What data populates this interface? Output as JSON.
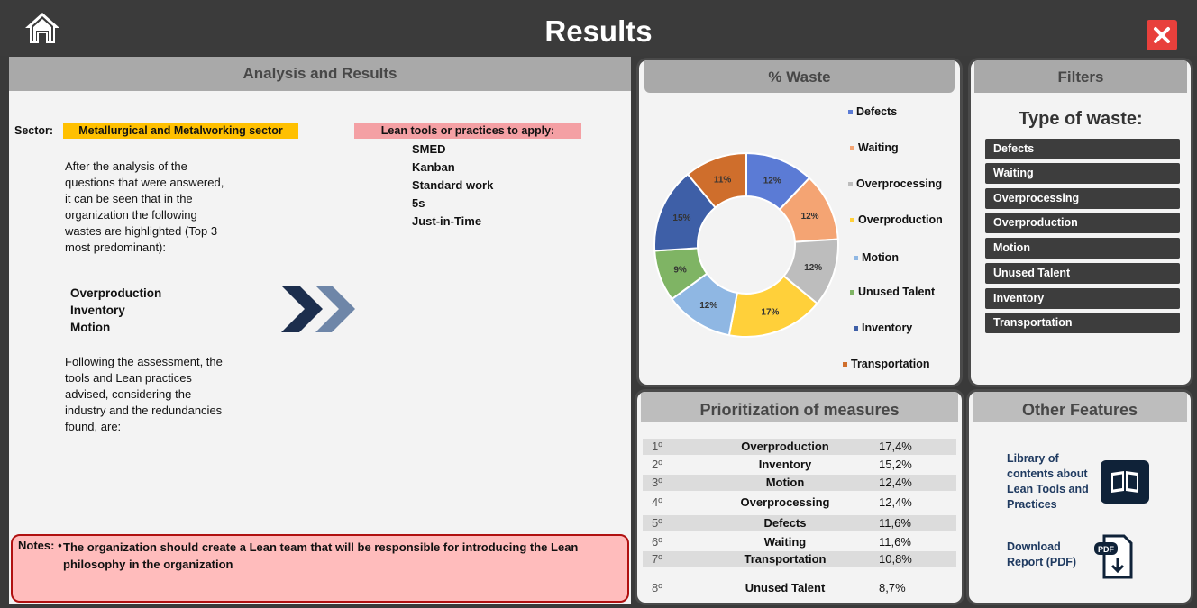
{
  "header": {
    "title": "Results"
  },
  "analysis": {
    "heading": "Analysis and Results",
    "sector_label": "Sector:",
    "sector_value": "Metallurgical and Metalworking sector",
    "intro_lines": [
      "After the analysis of the",
      "questions that were answered,",
      "it can be seen that in the",
      "organization the following",
      "wastes are highlighted (Top 3",
      "most predominant):"
    ],
    "top_wastes": [
      "Overproduction",
      "Inventory",
      "Motion"
    ],
    "followup_lines": [
      "Following the assessment, the",
      "tools and Lean practices",
      "advised, considering the",
      "industry and the redundancies",
      "found, are:"
    ],
    "lean_label": "Lean tools or practices to apply:",
    "lean_tools": [
      "SMED",
      "Kanban",
      "Standard work",
      "5s",
      "Just-in-Time"
    ],
    "notes_label": "Notes:",
    "notes_bullet": "•",
    "notes_text": "The organization should create a Lean team that will be responsible for introducing the Lean philosophy in the organization",
    "arrow_colors": [
      "#1c2e4d",
      "#6e86a8"
    ]
  },
  "waste_chart": {
    "heading": "% Waste",
    "chart_data": {
      "type": "pie",
      "subtype": "donut",
      "categories": [
        "Defects",
        "Waiting",
        "Overprocessing",
        "Overproduction",
        "Motion",
        "Unused Talent",
        "Inventory",
        "Transportation"
      ],
      "values": [
        12,
        12,
        12,
        17,
        12,
        9,
        15,
        11
      ],
      "labels": [
        "12%",
        "12%",
        "12%",
        "17%",
        "12%",
        "9%",
        "15%",
        "11%"
      ],
      "colors": [
        "#5b7bd5",
        "#f4a473",
        "#bdbdbd",
        "#ffd03a",
        "#8fb7e3",
        "#7fb464",
        "#3e5fa7",
        "#cf6e2c"
      ],
      "legend_position": "right"
    }
  },
  "filters": {
    "heading": "Filters",
    "title": "Type of waste:",
    "items": [
      "Defects",
      "Waiting",
      "Overprocessing",
      "Overproduction",
      "Motion",
      "Unused Talent",
      "Inventory",
      "Transportation"
    ]
  },
  "prioritization": {
    "heading": "Prioritization of measures",
    "rows": [
      {
        "rank": "1º",
        "name": "Overproduction",
        "value": "17,4%"
      },
      {
        "rank": "2º",
        "name": "Inventory",
        "value": "15,2%"
      },
      {
        "rank": "3º",
        "name": "Motion",
        "value": "12,4%"
      },
      {
        "rank": "4º",
        "name": "Overprocessing",
        "value": "12,4%"
      },
      {
        "rank": "5º",
        "name": "Defects",
        "value": "11,6%"
      },
      {
        "rank": "6º",
        "name": "Waiting",
        "value": "11,6%"
      },
      {
        "rank": "7º",
        "name": "Transportation",
        "value": "10,8%"
      },
      {
        "rank": "8º",
        "name": "Unused Talent",
        "value": "8,7%"
      }
    ]
  },
  "other_features": {
    "heading": "Other Features",
    "library_lines": [
      "Library of",
      "contents about",
      "Lean Tools and",
      "Practices"
    ],
    "download_lines": [
      "Download",
      "Report (PDF)"
    ],
    "pdf_badge": "PDF"
  },
  "icons": {
    "home": "home-icon",
    "close": "close-icon",
    "book": "book-icon",
    "pdf": "pdf-download-icon"
  }
}
